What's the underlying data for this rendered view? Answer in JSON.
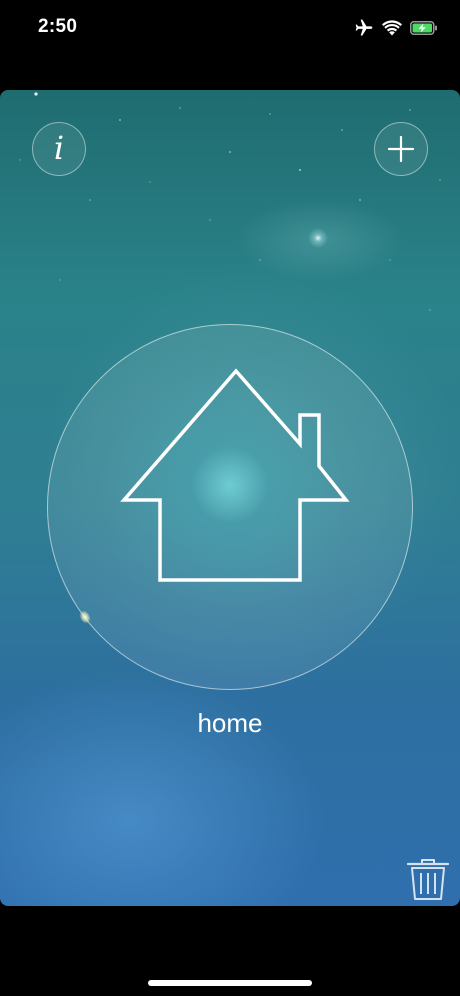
{
  "status_bar": {
    "time": "2:50",
    "icons": [
      "airplane-icon",
      "wifi-icon",
      "battery-charging-icon"
    ],
    "battery_color": "#4cd964"
  },
  "toolbar": {
    "info_icon": "info-icon",
    "info_glyph": "i",
    "add_icon": "plus-icon"
  },
  "scene": {
    "name": "home",
    "icon": "house-icon"
  },
  "actions": {
    "delete_icon": "trash-icon"
  },
  "colors": {
    "background_top": "#1f6c70",
    "background_bottom": "#2f6fae",
    "foreground": "#ffffff"
  }
}
